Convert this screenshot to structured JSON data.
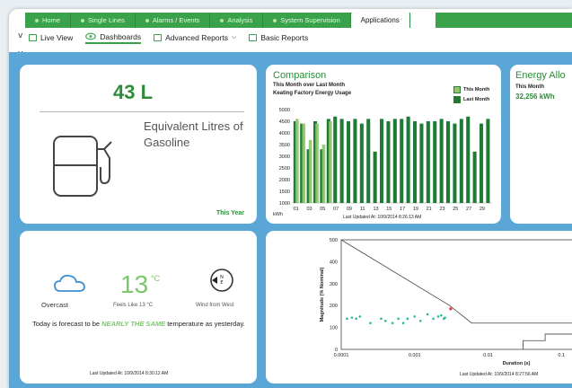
{
  "nav": {
    "tabs": [
      {
        "label": "Home"
      },
      {
        "label": "Single Lines"
      },
      {
        "label": "Alarms / Events"
      },
      {
        "label": "Analysis"
      },
      {
        "label": "System Supervision"
      },
      {
        "label": "Applications"
      }
    ],
    "sub": {
      "live_view": "Live View",
      "dashboards": "Dashboards",
      "advanced_reports": "Advanced Reports",
      "basic_reports": "Basic Reports"
    }
  },
  "gasoline": {
    "value": "43 L",
    "label": "Equivalent Litres of Gasoline",
    "period": "This Year"
  },
  "comparison": {
    "title": "Comparison",
    "subtitle1": "This Month over Last Month",
    "subtitle2": "Keating Factory Energy Usage",
    "legend_this": "This Month",
    "legend_last": "Last Month",
    "unit": "kWh",
    "updated": "Last Updated At: 10/9/2014 8:26:13 AM"
  },
  "energy": {
    "title": "Energy Allo",
    "sub": "This Month",
    "value": "32,256 kWh"
  },
  "weather": {
    "condition": "Overcast",
    "temp": "13",
    "deg": "°C",
    "feels_like": "Feels Like 13 °C",
    "wind": "Wind from West",
    "compass": "N",
    "forecast_pre": "Today is forecast to be ",
    "forecast_hl": "NEARLY THE SAME",
    "forecast_post": " temperature as yesterday.",
    "updated": "Last Updated At: 10/9/2014 8:30:12 AM"
  },
  "scatter": {
    "updated": "Last Updated At: 10/9/2014 8:27:56 AM"
  },
  "chart_data": [
    {
      "type": "bar",
      "categories": [
        "01",
        "02",
        "03",
        "04",
        "05",
        "06",
        "07",
        "08",
        "09",
        "10",
        "11",
        "12",
        "13",
        "14",
        "15",
        "16",
        "17",
        "18",
        "19",
        "20",
        "21",
        "22",
        "23",
        "24",
        "25",
        "26",
        "27",
        "28",
        "29",
        "30"
      ],
      "series": [
        {
          "name": "This Month",
          "values": [
            4600,
            4400,
            3700,
            4400,
            3500,
            4500,
            null,
            null,
            null,
            null,
            null,
            null,
            null,
            null,
            null,
            null,
            null,
            null,
            null,
            null,
            null,
            null,
            null,
            null,
            null,
            null,
            null,
            null,
            null,
            null
          ]
        },
        {
          "name": "Last Month",
          "values": [
            4500,
            4400,
            3300,
            4500,
            3300,
            4600,
            4700,
            4600,
            4500,
            4600,
            4400,
            4600,
            3200,
            4600,
            4500,
            4600,
            4600,
            4700,
            4500,
            4400,
            4500,
            4500,
            4600,
            4500,
            4400,
            4600,
            4700,
            3200,
            4400,
            4600
          ]
        }
      ],
      "xticks": [
        "01",
        "03",
        "05",
        "07",
        "09",
        "11",
        "13",
        "15",
        "17",
        "19",
        "21",
        "23",
        "25",
        "27",
        "29"
      ],
      "ylabel": "kWh",
      "ylim": [
        1000,
        5000
      ],
      "yticks": [
        1000,
        1500,
        2000,
        2500,
        3000,
        3500,
        4000,
        4500,
        5000
      ]
    },
    {
      "type": "scatter",
      "xlabel": "Duration (s)",
      "ylabel": "Magnitude (% Nominal)",
      "xscale": "log",
      "xlim": [
        0.0001,
        1
      ],
      "ylim": [
        0,
        500
      ],
      "xticks": [
        "0.0001",
        "0.001",
        "0.01",
        "0.1"
      ],
      "yticks": [
        0,
        100,
        200,
        300,
        400,
        500
      ],
      "points": [
        [
          0.00012,
          140
        ],
        [
          0.00014,
          145
        ],
        [
          0.00016,
          140
        ],
        [
          0.00018,
          150
        ],
        [
          0.00025,
          120
        ],
        [
          0.00035,
          140
        ],
        [
          0.0004,
          130
        ],
        [
          0.0005,
          120
        ],
        [
          0.0006,
          140
        ],
        [
          0.0007,
          120
        ],
        [
          0.0008,
          140
        ],
        [
          0.001,
          150
        ],
        [
          0.0012,
          130
        ],
        [
          0.0015,
          160
        ],
        [
          0.0018,
          140
        ],
        [
          0.0021,
          150
        ],
        [
          0.0023,
          155
        ],
        [
          0.0025,
          140
        ],
        [
          0.0026,
          145
        ]
      ],
      "outlier": [
        [
          0.0031,
          185
        ]
      ],
      "curve_upper": [
        [
          0.0001,
          500
        ],
        [
          0.003,
          200
        ],
        [
          0.006,
          120
        ],
        [
          1,
          120
        ]
      ],
      "curve_lower": [
        [
          0.03,
          0
        ],
        [
          0.03,
          40
        ],
        [
          0.06,
          40
        ],
        [
          0.06,
          70
        ],
        [
          1,
          70
        ]
      ]
    }
  ]
}
